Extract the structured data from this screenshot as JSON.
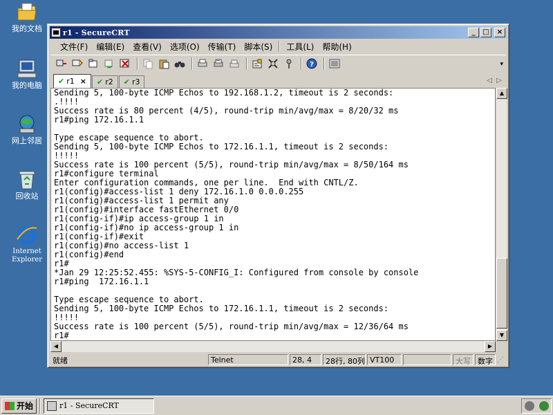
{
  "desktop": {
    "icons": [
      {
        "label": "我的文档",
        "icon": "my-documents-icon"
      },
      {
        "label": "我的电脑",
        "icon": "my-computer-icon"
      },
      {
        "label": "网上邻居",
        "icon": "network-icon"
      },
      {
        "label": "回收站",
        "icon": "recycle-bin-icon"
      },
      {
        "label": "Internet Explorer",
        "icon": "internet-explorer-icon"
      }
    ]
  },
  "window": {
    "title": "r1 - SecureCRT",
    "controls": {
      "minimize": "_",
      "maximize": "□",
      "close": "×"
    }
  },
  "menu": {
    "file": "文件(F)",
    "edit": "编辑(E)",
    "view": "查看(V)",
    "options": "选项(O)",
    "transfer": "传输(T)",
    "script": "脚本(S)",
    "tools": "工具(L)",
    "help": "帮助(H)"
  },
  "toolbar": {
    "icons": [
      "connect-icon",
      "quick-connect-icon",
      "connect-tab-icon",
      "reconnect-icon",
      "disconnect-icon",
      "copy-icon",
      "paste-icon",
      "find-icon",
      "print-icon",
      "print-selection-icon",
      "print-setup-icon",
      "session-options-icon",
      "global-options-icon",
      "keymap-icon",
      "help-icon",
      "sftp-icon"
    ]
  },
  "tabs": [
    {
      "label": "r1",
      "active": true,
      "close": "×"
    },
    {
      "label": "r2",
      "active": false
    },
    {
      "label": "r3",
      "active": false
    }
  ],
  "terminal": {
    "lines": [
      "Sending 5, 100-byte ICMP Echos to 192.168.1.2, timeout is 2 seconds:",
      ".!!!!",
      "Success rate is 80 percent (4/5), round-trip min/avg/max = 8/20/32 ms",
      "r1#ping 172.16.1.1",
      "",
      "Type escape sequence to abort.",
      "Sending 5, 100-byte ICMP Echos to 172.16.1.1, timeout is 2 seconds:",
      "!!!!!",
      "Success rate is 100 percent (5/5), round-trip min/avg/max = 8/50/164 ms",
      "r1#configure terminal",
      "Enter configuration commands, one per line.  End with CNTL/Z.",
      "r1(config)#access-list 1 deny 172.16.1.0 0.0.0.255",
      "r1(config)#access-list 1 permit any",
      "r1(config)#interface fastEthernet 0/0",
      "r1(config-if)#ip access-group 1 in",
      "r1(config-if)#no ip access-group 1 in",
      "r1(config-if)#exit",
      "r1(config)#no access-list 1",
      "r1(config)#end",
      "r1#",
      "*Jan 29 12:25:52.455: %SYS-5-CONFIG_I: Configured from console by console",
      "r1#ping  172.16.1.1",
      "",
      "Type escape sequence to abort.",
      "Sending 5, 100-byte ICMP Echos to 172.16.1.1, timeout is 2 seconds:",
      "!!!!!",
      "Success rate is 100 percent (5/5), round-trip min/avg/max = 12/36/64 ms",
      "r1#"
    ]
  },
  "statusbar": {
    "ready": "就绪",
    "protocol": "Telnet",
    "cursor": "28,  4",
    "size": "28行, 80列",
    "emulation": "VT100",
    "blank": "",
    "caps": "大写",
    "num": "数字"
  },
  "taskbar": {
    "start": "开始",
    "task": "r1 - SecureCRT"
  }
}
